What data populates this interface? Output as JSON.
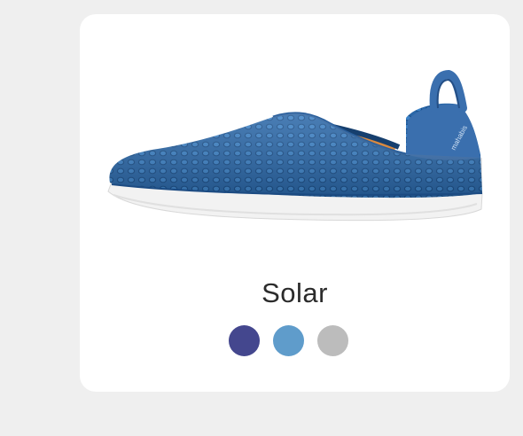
{
  "product": {
    "name": "Solar",
    "brand_mark": "mahabis",
    "image_icon": "blue-mesh-slip-on-shoe"
  },
  "swatches": [
    {
      "name": "navy",
      "color": "#44478e"
    },
    {
      "name": "light-blue",
      "color": "#5f9ccb"
    },
    {
      "name": "grey",
      "color": "#bcbcbc"
    }
  ],
  "colors": {
    "background": "#efefef",
    "card": "#ffffff",
    "shoe_mesh": "#2f6fb0",
    "shoe_sole": "#f4f4f4"
  }
}
